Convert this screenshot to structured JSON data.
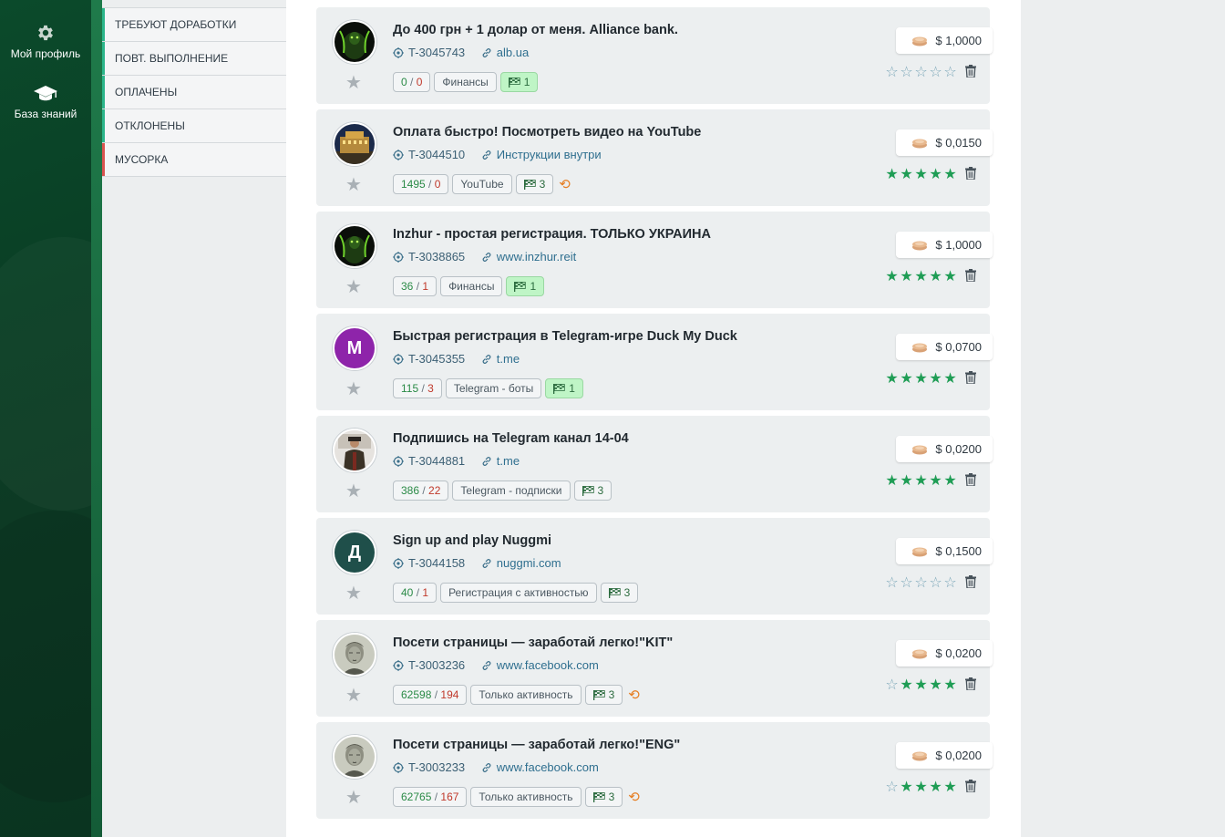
{
  "sidebar": {
    "items": [
      {
        "label": "Мой профиль",
        "icon": "gear-icon"
      },
      {
        "label": "База знаний",
        "icon": "graduation-cap-icon"
      }
    ]
  },
  "submenu": {
    "items": [
      {
        "label": "ТРЕБУЮТ ДОРАБОТКИ"
      },
      {
        "label": "ПОВТ. ВЫПОЛНЕНИЕ"
      },
      {
        "label": "ОПЛАЧЕНЫ"
      },
      {
        "label": "ОТКЛОНЕНЫ"
      },
      {
        "label": "МУСОРКА"
      }
    ]
  },
  "colors": {
    "accent_green": "#1f9d55",
    "brand_dark_green": "#0b4a2b",
    "rejected_red": "#c0392b",
    "repeat_orange": "#e67e22",
    "highlight_flag": "#bff5c6"
  },
  "tasks": [
    {
      "title": "До 400 грн + 1 долар от меня. Alliance bank.",
      "id": "T-3045743",
      "link": "alb.ua",
      "done": "0",
      "rejected": "0",
      "category": "Финансы",
      "flags": "1",
      "flag_highlight": true,
      "repeat": false,
      "price": "$ 1,0000",
      "rating": 0,
      "avatar": {
        "type": "image",
        "icon": "dark-green-figure-avatar"
      }
    },
    {
      "title": "Оплата быстро! Посмотреть видео на YouTube",
      "id": "T-3044510",
      "link": "Инструкции внутри",
      "done": "1495",
      "rejected": "0",
      "category": "YouTube",
      "flags": "3",
      "flag_highlight": false,
      "repeat": true,
      "price": "$ 0,0150",
      "rating": 5,
      "avatar": {
        "type": "image",
        "icon": "night-building-avatar"
      }
    },
    {
      "title": "Inzhur - простая регистрация. ТОЛЬКО УКРАИНА",
      "id": "T-3038865",
      "link": "www.inzhur.reit",
      "done": "36",
      "rejected": "1",
      "category": "Финансы",
      "flags": "1",
      "flag_highlight": true,
      "repeat": false,
      "price": "$ 1,0000",
      "rating": 5,
      "avatar": {
        "type": "image",
        "icon": "dark-green-figure-avatar"
      }
    },
    {
      "title": "Быстрая регистрация в Telegram-игре Duck My Duck",
      "id": "T-3045355",
      "link": "t.me",
      "done": "115",
      "rejected": "3",
      "category": "Telegram - боты",
      "flags": "1",
      "flag_highlight": true,
      "repeat": false,
      "price": "$ 0,0700",
      "rating": 5,
      "avatar": {
        "type": "letter",
        "letter": "М",
        "color": "#8e24aa"
      }
    },
    {
      "title": "Подпишись на Telegram канал 14-04",
      "id": "T-3044881",
      "link": "t.me",
      "done": "386",
      "rejected": "22",
      "category": "Telegram - подписки",
      "flags": "3",
      "flag_highlight": false,
      "repeat": false,
      "price": "$ 0,0200",
      "rating": 5,
      "avatar": {
        "type": "image",
        "icon": "person-photo-avatar"
      }
    },
    {
      "title": "Sign up and play Nuggmi",
      "id": "T-3044158",
      "link": "nuggmi.com",
      "done": "40",
      "rejected": "1",
      "category": "Регистрация с активностью",
      "flags": "3",
      "flag_highlight": false,
      "repeat": false,
      "price": "$ 0,1500",
      "rating": 0,
      "avatar": {
        "type": "letter",
        "letter": "Д",
        "color": "#1f4f4a"
      }
    },
    {
      "title": "Посети страницы — заработай легко!\"KIT\"",
      "id": "T-3003236",
      "link": "www.facebook.com",
      "done": "62598",
      "rejected": "194",
      "category": "Только активность",
      "flags": "3",
      "flag_highlight": false,
      "repeat": true,
      "price": "$ 0,0200",
      "rating": 4,
      "avatar": {
        "type": "image",
        "icon": "banknote-portrait-avatar"
      }
    },
    {
      "title": "Посети страницы — заработай легко!\"ENG\"",
      "id": "T-3003233",
      "link": "www.facebook.com",
      "done": "62765",
      "rejected": "167",
      "category": "Только активность",
      "flags": "3",
      "flag_highlight": false,
      "repeat": true,
      "price": "$ 0,0200",
      "rating": 4,
      "avatar": {
        "type": "image",
        "icon": "banknote-portrait-avatar"
      }
    }
  ]
}
